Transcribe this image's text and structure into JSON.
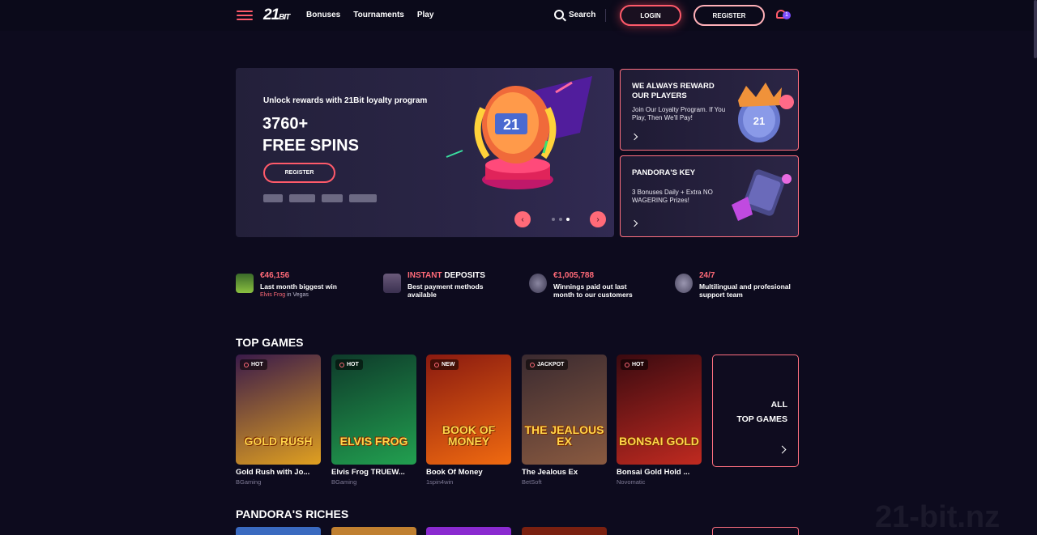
{
  "header": {
    "logo": "21",
    "logo_suffix": "BIT",
    "nav": [
      "Bonuses",
      "Tournaments",
      "Play"
    ],
    "search_label": "Search",
    "login_label": "LOGIN",
    "register_label": "REGISTER",
    "notification_count": "1"
  },
  "hero": {
    "tagline": "Unlock rewards with 21Bit loyalty program",
    "title_line1": "3760+",
    "title_line2": "FREE SPINS",
    "register_label": "REGISTER",
    "badge_number": "21",
    "slide_count": 3,
    "active_slide": 2
  },
  "promos": [
    {
      "title": "WE ALWAYS REWARD OUR PLAYERS",
      "text": "Join Our Loyalty Program. If You Play, Then We'll Pay!"
    },
    {
      "title": "PANDORA'S KEY",
      "text": "3 Bonuses Daily + Extra NO WAGERING Prizes!"
    }
  ],
  "stats": [
    {
      "head_pink": "€46,156",
      "head_white": "",
      "sub": "Last month biggest win",
      "extra_pink": "Elvis Frog",
      "extra_rest": " in Vegas"
    },
    {
      "head_pink": "INSTANT",
      "head_white": " DEPOSITS",
      "sub": "Best payment methods available",
      "extra_pink": "",
      "extra_rest": ""
    },
    {
      "head_pink": "€1,005,788",
      "head_white": "",
      "sub": "Winnings paid out last month to our customers",
      "extra_pink": "",
      "extra_rest": ""
    },
    {
      "head_pink": "24/7",
      "head_white": "",
      "sub": "Multilingual and profesional support team",
      "extra_pink": "",
      "extra_rest": ""
    }
  ],
  "top_games": {
    "title": "TOP GAMES",
    "games": [
      {
        "name": "Gold Rush with Jo...",
        "provider": "BGaming",
        "badge": "HOT",
        "art": "GOLD RUSH",
        "color1": "#3a1a4a",
        "color2": "#e0a020"
      },
      {
        "name": "Elvis Frog TRUEW...",
        "provider": "BGaming",
        "badge": "HOT",
        "art": "ELVIS FROG",
        "color1": "#0e3a2a",
        "color2": "#22a050"
      },
      {
        "name": "Book Of Money",
        "provider": "1spin4win",
        "badge": "NEW",
        "art": "BOOK OF MONEY",
        "color1": "#8a1a10",
        "color2": "#f06a10"
      },
      {
        "name": "The Jealous Ex",
        "provider": "BetSoft",
        "badge": "JACKPOT",
        "art": "THE JEALOUS EX",
        "color1": "#3a2a30",
        "color2": "#8a5a40"
      },
      {
        "name": "Bonsai Gold Hold ...",
        "provider": "Novomatic",
        "badge": "HOT",
        "art": "BONSAI GOLD",
        "color1": "#3a0a10",
        "color2": "#c02a20"
      }
    ],
    "all_label_line1": "ALL",
    "all_label_line2": "TOP GAMES"
  },
  "pandora": {
    "title": "PANDORA'S RICHES"
  },
  "watermark": "21-bit.nz",
  "colors": {
    "accent": "#ff5a6a",
    "background": "#0d0b1e",
    "panel": "#23203a"
  }
}
